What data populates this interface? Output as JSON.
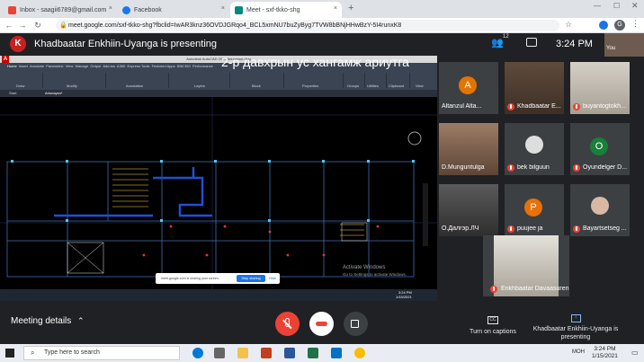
{
  "browser": {
    "tabs": [
      {
        "label": "Inbox - saagii6789@gmail.com",
        "close": "×"
      },
      {
        "label": "Facebook",
        "close": "×"
      },
      {
        "label": "Meet - sxf-tkko-shg",
        "close": "×"
      }
    ],
    "new_tab": "+",
    "url": "meet.google.com/sxf-tkko-shg?fbclid=IwAR3knz36OVDJGRqo4_BCL5xmNU7buZyByg7TVW8bBNjHHwBzY-5I4runxK8",
    "profile_initial": "G"
  },
  "meet": {
    "presenter_initial": "K",
    "presenter_title": "Khadbaatar Enkhiin-Uyanga is presenting",
    "participant_count": "12",
    "clock": "3:24 PM",
    "you_label": "You"
  },
  "shared_screen": {
    "app_title": "Autodesk AutoCAD 2016   Ariunaysn.dwg",
    "ribbon_tabs": [
      "Home",
      "Insert",
      "Annotate",
      "Parametric",
      "View",
      "Manage",
      "Output",
      "Add-ins",
      "A360",
      "Express Tools",
      "Featured Apps",
      "BIM 360",
      "Performance"
    ],
    "ribbon_groups": [
      "Draw",
      "Modify",
      "Annotation",
      "Layers",
      "Block",
      "Properties",
      "Groups",
      "Utilities",
      "Clipboard",
      "View"
    ],
    "sheet_tabs": [
      "Start",
      "Ariunaysn*"
    ],
    "sheet_title": "2-р давхрын ус хангамж ариутга",
    "layout_tabs": [
      "Model",
      "Layout1",
      "Layout2"
    ],
    "share_notice": "meet.google.com is sharing your screen.",
    "stop_sharing": "Stop sharing",
    "hide": "Hide",
    "activate_title": "Activate Windows",
    "activate_sub": "Go to Settings to activate Windows.",
    "inner_time": "3:24 PM",
    "inner_date": "1/15/2021"
  },
  "participants": [
    {
      "name": "Altanzul Alta...",
      "initial": "A",
      "color": "#e37400",
      "muted": false
    },
    {
      "name": "Khadbaatar E...",
      "initial": "",
      "color": "#5f4b3b",
      "muted": true
    },
    {
      "name": "buyantogtokh...",
      "initial": "",
      "color": "#c4beb4",
      "muted": true
    },
    {
      "name": "D.Munguntulga",
      "initial": "",
      "color": "#8a6a55",
      "muted": false
    },
    {
      "name": "bek bilguun",
      "initial": "",
      "color": "#3c4043",
      "muted": true
    },
    {
      "name": "Oyundelger D...",
      "initial": "O",
      "color": "#188038",
      "muted": true
    },
    {
      "name": "O.Далгэр.ЛЧ",
      "initial": "",
      "color": "#4a4a4a",
      "muted": false
    },
    {
      "name": "puujee ja",
      "initial": "P",
      "color": "#e8710a",
      "muted": true
    },
    {
      "name": "Bayartsetseg ...",
      "initial": "",
      "color": "#3c4043",
      "muted": true
    },
    {
      "name": "Enkhbaatar Davaasuren",
      "initial": "",
      "color": "#d9d6cf",
      "muted": true
    }
  ],
  "bottom_bar": {
    "meeting_details": "Meeting details",
    "captions": "Turn on captions",
    "presenting": "Khadbaatar Enkhiin-Uyanga is presenting",
    "cc": "CC"
  },
  "taskbar": {
    "search_placeholder": "Type here to search",
    "time": "3:24 PM",
    "date": "1/15/2021",
    "lang": "МОН"
  }
}
